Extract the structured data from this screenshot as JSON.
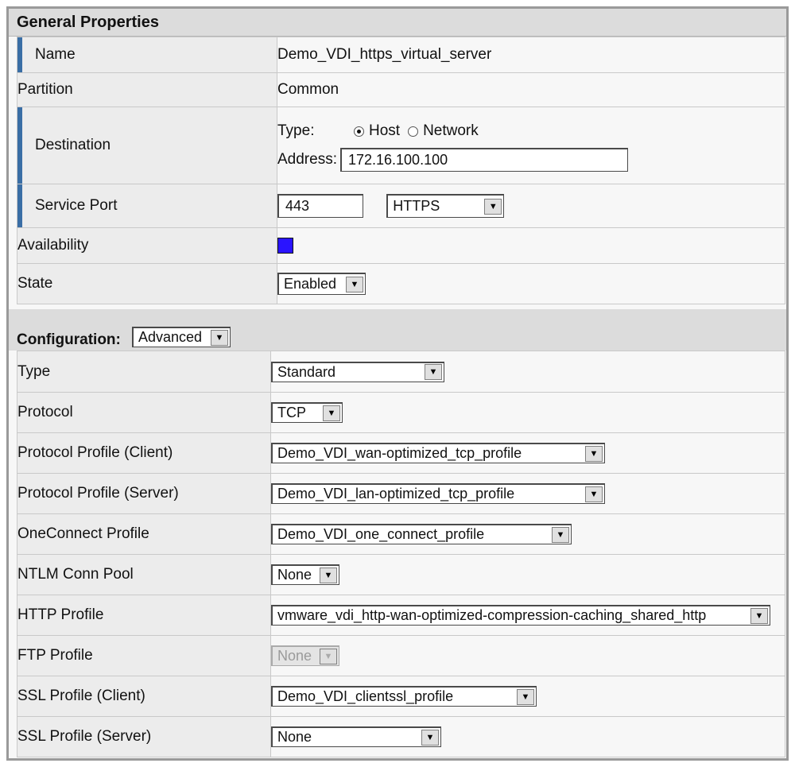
{
  "general": {
    "title": "General Properties",
    "name_label": "Name",
    "name_value": "Demo_VDI_https_virtual_server",
    "partition_label": "Partition",
    "partition_value": "Common",
    "destination_label": "Destination",
    "type_label": "Type:",
    "host_label": "Host",
    "network_label": "Network",
    "address_label": "Address:",
    "address_value": "172.16.100.100",
    "service_port_label": "Service Port",
    "port_value": "443",
    "port_select": "HTTPS",
    "availability_label": "Availability",
    "availability_color": "#2a14ff",
    "state_label": "State",
    "state_select": "Enabled"
  },
  "config": {
    "label": "Configuration:",
    "select": "Advanced",
    "rows": [
      {
        "label": "Type",
        "value": "Standard"
      },
      {
        "label": "Protocol",
        "value": "TCP"
      },
      {
        "label": "Protocol Profile (Client)",
        "value": "Demo_VDI_wan-optimized_tcp_profile"
      },
      {
        "label": "Protocol Profile (Server)",
        "value": "Demo_VDI_lan-optimized_tcp_profile"
      },
      {
        "label": "OneConnect Profile",
        "value": "Demo_VDI_one_connect_profile"
      },
      {
        "label": "NTLM Conn Pool",
        "value": "None"
      },
      {
        "label": "HTTP Profile",
        "value": "vmware_vdi_http-wan-optimized-compression-caching_shared_http"
      },
      {
        "label": "FTP Profile",
        "value": "None"
      },
      {
        "label": "SSL Profile (Client)",
        "value": "Demo_VDI_clientssl_profile"
      },
      {
        "label": "SSL Profile (Server)",
        "value": "None"
      }
    ]
  },
  "icons": {
    "dropdown": "chevron-down-icon"
  }
}
